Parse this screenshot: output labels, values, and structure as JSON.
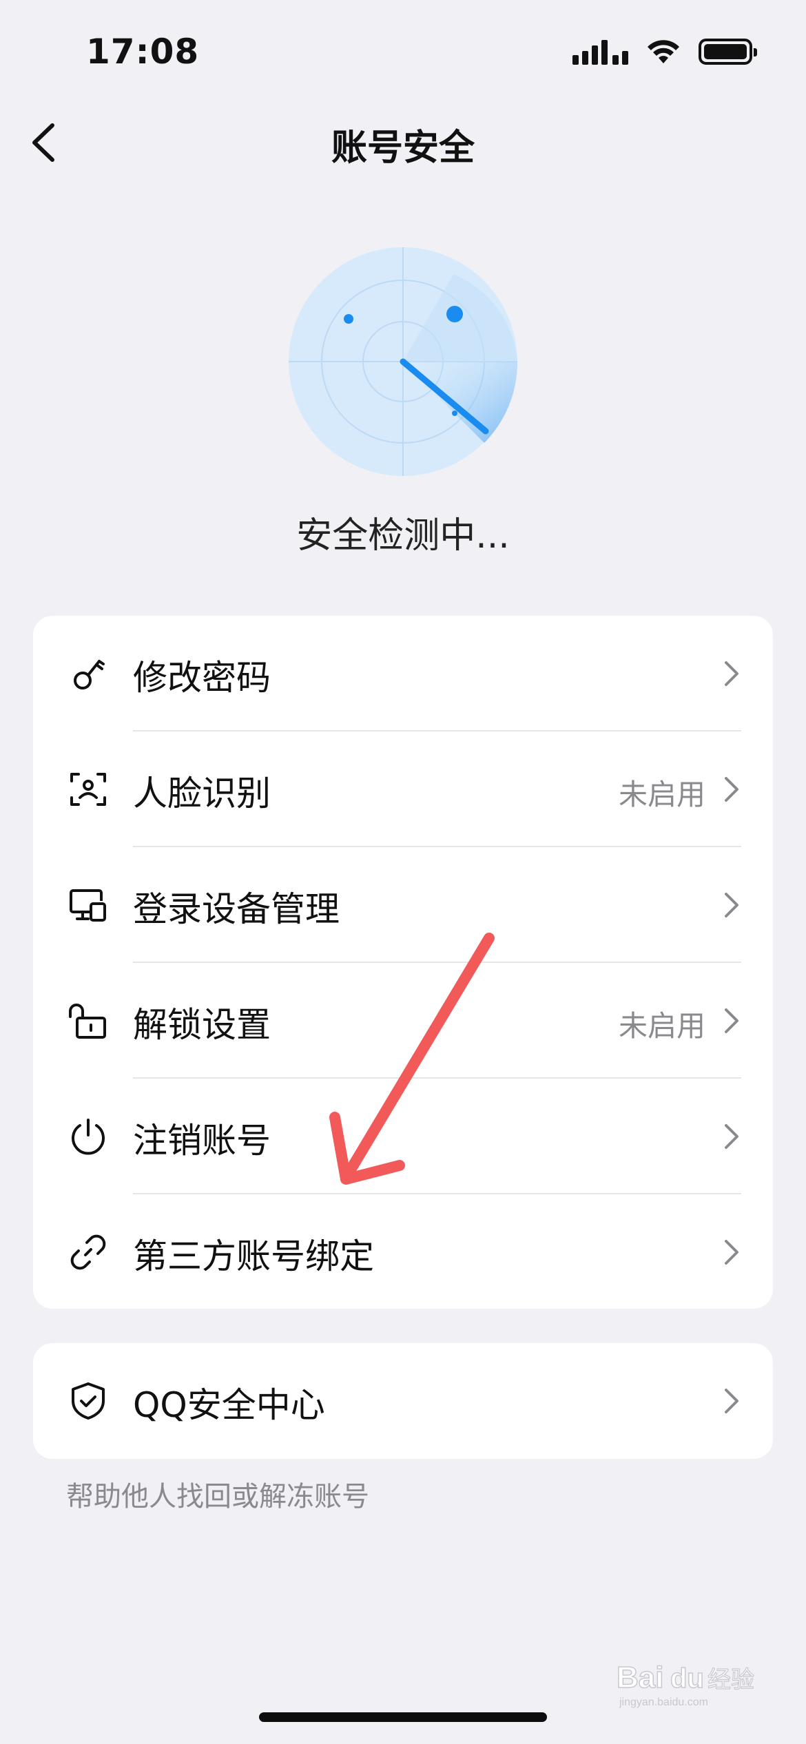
{
  "status_bar": {
    "time": "17:08",
    "icons": [
      "cellular-signal-icon",
      "wifi-icon",
      "battery-icon"
    ]
  },
  "nav": {
    "title": "账号安全",
    "back_icon": "chevron-left-icon"
  },
  "scan": {
    "status_text": "安全检测中..."
  },
  "menu": {
    "items": [
      {
        "label": "修改密码",
        "status": "",
        "icon": "key-icon"
      },
      {
        "label": "人脸识别",
        "status": "未启用",
        "icon": "face-scan-icon"
      },
      {
        "label": "登录设备管理",
        "status": "",
        "icon": "devices-icon"
      },
      {
        "label": "解锁设置",
        "status": "未启用",
        "icon": "unlock-icon"
      },
      {
        "label": "注销账号",
        "status": "",
        "icon": "power-icon"
      },
      {
        "label": "第三方账号绑定",
        "status": "",
        "icon": "link-icon"
      }
    ]
  },
  "security_center": {
    "label": "QQ安全中心",
    "icon": "shield-check-icon",
    "helper_text": "帮助他人找回或解冻账号"
  },
  "watermark": {
    "text": "Bai du 经验",
    "sub": "jingyan.baidu.com"
  },
  "colors": {
    "accent": "#1a8cf0",
    "radar_fill": "#d7eafb",
    "annotation_arrow": "#f25a5a",
    "background": "#f0f0f5",
    "secondary_text": "#8a8a8e"
  }
}
